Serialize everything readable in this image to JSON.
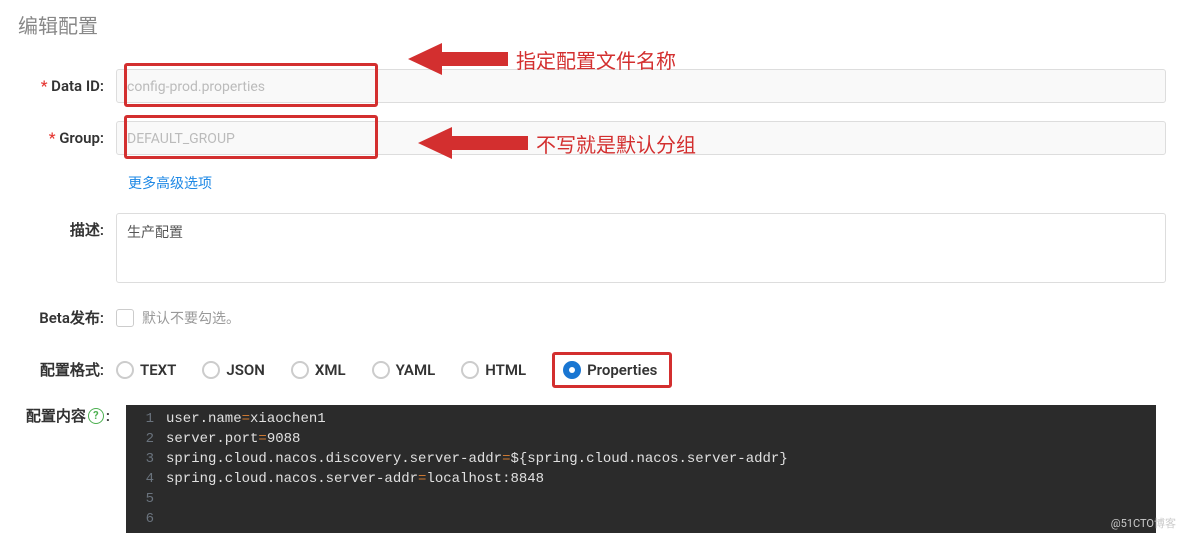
{
  "pageTitle": "编辑配置",
  "annotations": {
    "dataId": "指定配置文件名称",
    "group": "不写就是默认分组"
  },
  "labels": {
    "dataId": "Data ID:",
    "group": "Group:",
    "advanced": "更多高级选项",
    "description": "描述:",
    "beta": "Beta发布:",
    "betaHint": "默认不要勾选。",
    "format": "配置格式:",
    "content": "配置内容",
    "help": "?"
  },
  "inputs": {
    "dataId": "config-prod.properties",
    "group": "DEFAULT_GROUP",
    "description": "生产配置"
  },
  "formats": [
    {
      "label": "TEXT",
      "selected": false
    },
    {
      "label": "JSON",
      "selected": false
    },
    {
      "label": "XML",
      "selected": false
    },
    {
      "label": "YAML",
      "selected": false
    },
    {
      "label": "HTML",
      "selected": false
    },
    {
      "label": "Properties",
      "selected": true
    }
  ],
  "codeLines": [
    "user.name=xiaochen1",
    "server.port=9088",
    "spring.cloud.nacos.discovery.server-addr=${spring.cloud.nacos.server-addr}",
    "spring.cloud.nacos.server-addr=localhost:8848",
    "",
    ""
  ],
  "watermark": "@51CTO博客"
}
